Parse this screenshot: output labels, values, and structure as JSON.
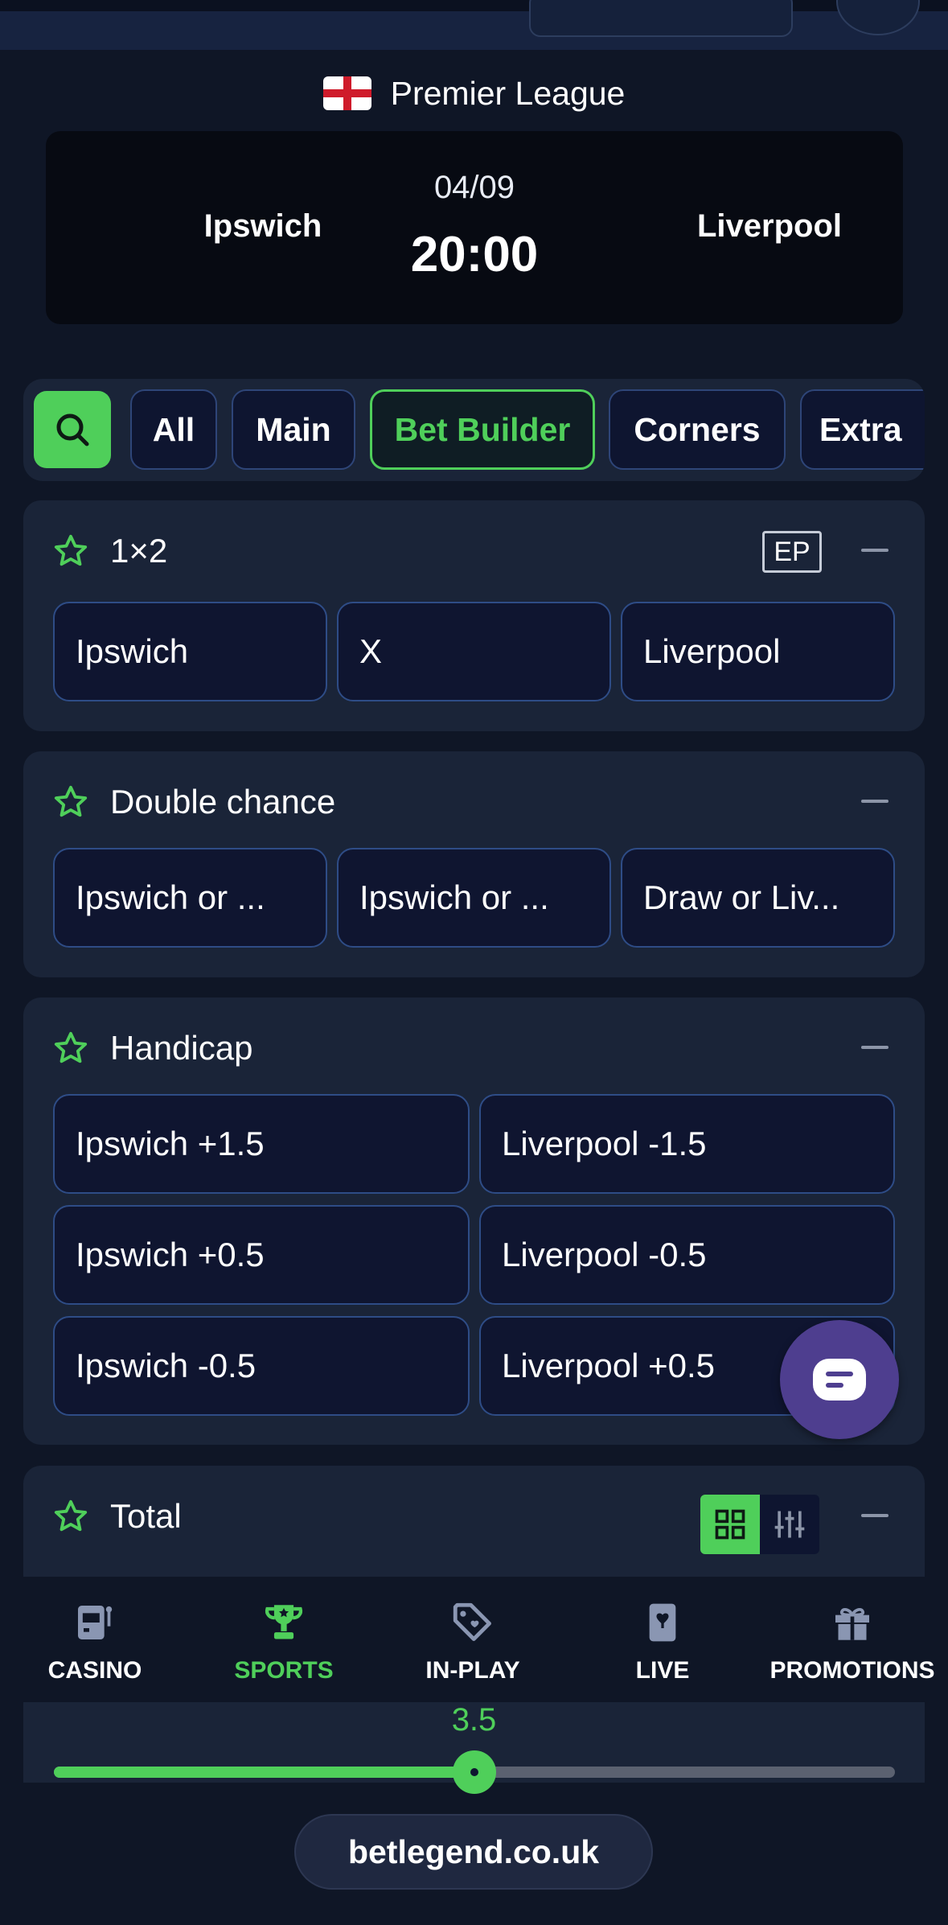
{
  "league": {
    "name": "Premier League",
    "flag": "england-flag"
  },
  "match": {
    "home": "Ipswich",
    "away": "Liverpool",
    "date": "04/09",
    "time": "20:00"
  },
  "tabs": [
    {
      "label": "All",
      "active": false
    },
    {
      "label": "Main",
      "active": false
    },
    {
      "label": "Bet Builder",
      "active": true
    },
    {
      "label": "Corners",
      "active": false
    },
    {
      "label": "Extra",
      "active": false
    }
  ],
  "markets": {
    "one_x_two": {
      "title": "1×2",
      "badge": "EP",
      "selections": [
        "Ipswich",
        "X",
        "Liverpool"
      ]
    },
    "double_chance": {
      "title": "Double chance",
      "selections": [
        "Ipswich or ...",
        "Ipswich or ...",
        "Draw or Liv..."
      ]
    },
    "handicap": {
      "title": "Handicap",
      "selections": [
        "Ipswich +1.5",
        "Liverpool -1.5",
        "Ipswich +0.5",
        "Liverpool -0.5",
        "Ipswich -0.5",
        "Liverpool +0.5"
      ]
    },
    "total": {
      "title": "Total",
      "line": "3.5",
      "slider_fraction": 0.5
    }
  },
  "nav": {
    "casino": "CASINO",
    "sports": "SPORTS",
    "inplay": "IN-PLAY",
    "live": "LIVE",
    "promotions": "PROMOTIONS"
  },
  "footer": {
    "url": "betlegend.co.uk"
  },
  "colors": {
    "accent": "#4fcf5a",
    "background": "#0f1626",
    "panel": "#1a2438",
    "chat": "#4e3e8f"
  }
}
